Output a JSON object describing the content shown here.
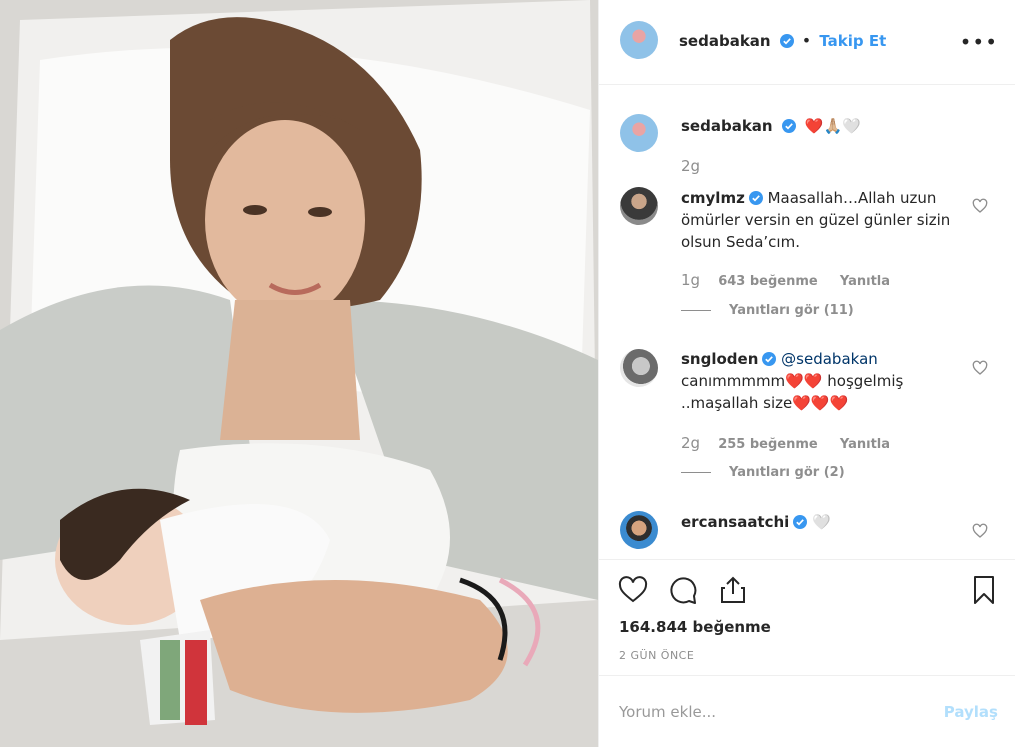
{
  "post": {
    "username": "sedabakan",
    "follow_label": "Takip Et",
    "caption_emoji": "❤️🙏🏼🤍",
    "caption_time": "2g",
    "likes": "164.844 beğenme",
    "date": "2 GÜN ÖNCE",
    "comment_placeholder": "Yorum ekle...",
    "post_button": "Paylaş"
  },
  "comments": [
    {
      "username": "cmylmz",
      "text": "Maasallah…Allah uzun ömürler versin en güzel günler sizin olsun Seda’cım.",
      "time": "1g",
      "likes": "643 beğenme",
      "reply": "Yanıtla",
      "view_replies": "Yanıtları gör (11)"
    },
    {
      "username": "sngloden",
      "mention": "@sedabakan",
      "text": "canımmmmm❤️❤️ hoşgelmiş ..maşallah size❤️❤️❤️",
      "time": "2g",
      "likes": "255 beğenme",
      "reply": "Yanıtla",
      "view_replies": "Yanıtları gör (2)"
    },
    {
      "username": "ercansaatchi",
      "text": "🤍"
    }
  ],
  "colors": {
    "link": "#3897f0",
    "text": "#262626",
    "muted": "#8e8e8e"
  }
}
